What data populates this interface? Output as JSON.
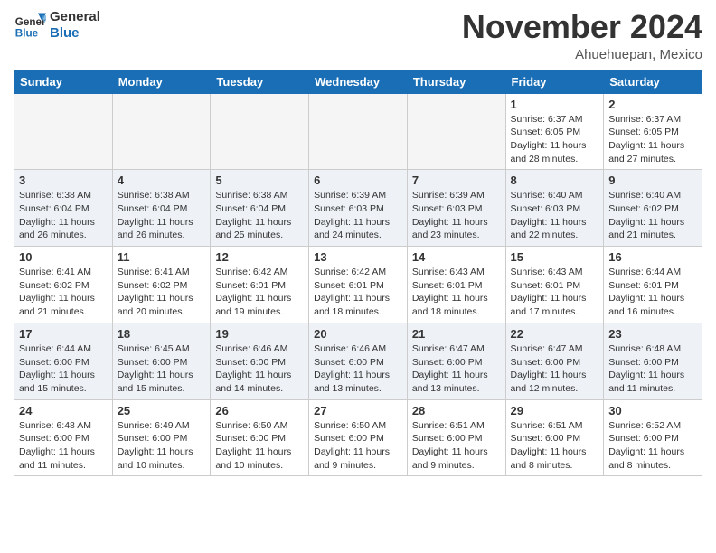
{
  "header": {
    "logo_general": "General",
    "logo_blue": "Blue",
    "month": "November 2024",
    "location": "Ahuehuepan, Mexico"
  },
  "weekdays": [
    "Sunday",
    "Monday",
    "Tuesday",
    "Wednesday",
    "Thursday",
    "Friday",
    "Saturday"
  ],
  "weeks": [
    [
      {
        "day": "",
        "info": ""
      },
      {
        "day": "",
        "info": ""
      },
      {
        "day": "",
        "info": ""
      },
      {
        "day": "",
        "info": ""
      },
      {
        "day": "",
        "info": ""
      },
      {
        "day": "1",
        "info": "Sunrise: 6:37 AM\nSunset: 6:05 PM\nDaylight: 11 hours and 28 minutes."
      },
      {
        "day": "2",
        "info": "Sunrise: 6:37 AM\nSunset: 6:05 PM\nDaylight: 11 hours and 27 minutes."
      }
    ],
    [
      {
        "day": "3",
        "info": "Sunrise: 6:38 AM\nSunset: 6:04 PM\nDaylight: 11 hours and 26 minutes."
      },
      {
        "day": "4",
        "info": "Sunrise: 6:38 AM\nSunset: 6:04 PM\nDaylight: 11 hours and 26 minutes."
      },
      {
        "day": "5",
        "info": "Sunrise: 6:38 AM\nSunset: 6:04 PM\nDaylight: 11 hours and 25 minutes."
      },
      {
        "day": "6",
        "info": "Sunrise: 6:39 AM\nSunset: 6:03 PM\nDaylight: 11 hours and 24 minutes."
      },
      {
        "day": "7",
        "info": "Sunrise: 6:39 AM\nSunset: 6:03 PM\nDaylight: 11 hours and 23 minutes."
      },
      {
        "day": "8",
        "info": "Sunrise: 6:40 AM\nSunset: 6:03 PM\nDaylight: 11 hours and 22 minutes."
      },
      {
        "day": "9",
        "info": "Sunrise: 6:40 AM\nSunset: 6:02 PM\nDaylight: 11 hours and 21 minutes."
      }
    ],
    [
      {
        "day": "10",
        "info": "Sunrise: 6:41 AM\nSunset: 6:02 PM\nDaylight: 11 hours and 21 minutes."
      },
      {
        "day": "11",
        "info": "Sunrise: 6:41 AM\nSunset: 6:02 PM\nDaylight: 11 hours and 20 minutes."
      },
      {
        "day": "12",
        "info": "Sunrise: 6:42 AM\nSunset: 6:01 PM\nDaylight: 11 hours and 19 minutes."
      },
      {
        "day": "13",
        "info": "Sunrise: 6:42 AM\nSunset: 6:01 PM\nDaylight: 11 hours and 18 minutes."
      },
      {
        "day": "14",
        "info": "Sunrise: 6:43 AM\nSunset: 6:01 PM\nDaylight: 11 hours and 18 minutes."
      },
      {
        "day": "15",
        "info": "Sunrise: 6:43 AM\nSunset: 6:01 PM\nDaylight: 11 hours and 17 minutes."
      },
      {
        "day": "16",
        "info": "Sunrise: 6:44 AM\nSunset: 6:01 PM\nDaylight: 11 hours and 16 minutes."
      }
    ],
    [
      {
        "day": "17",
        "info": "Sunrise: 6:44 AM\nSunset: 6:00 PM\nDaylight: 11 hours and 15 minutes."
      },
      {
        "day": "18",
        "info": "Sunrise: 6:45 AM\nSunset: 6:00 PM\nDaylight: 11 hours and 15 minutes."
      },
      {
        "day": "19",
        "info": "Sunrise: 6:46 AM\nSunset: 6:00 PM\nDaylight: 11 hours and 14 minutes."
      },
      {
        "day": "20",
        "info": "Sunrise: 6:46 AM\nSunset: 6:00 PM\nDaylight: 11 hours and 13 minutes."
      },
      {
        "day": "21",
        "info": "Sunrise: 6:47 AM\nSunset: 6:00 PM\nDaylight: 11 hours and 13 minutes."
      },
      {
        "day": "22",
        "info": "Sunrise: 6:47 AM\nSunset: 6:00 PM\nDaylight: 11 hours and 12 minutes."
      },
      {
        "day": "23",
        "info": "Sunrise: 6:48 AM\nSunset: 6:00 PM\nDaylight: 11 hours and 11 minutes."
      }
    ],
    [
      {
        "day": "24",
        "info": "Sunrise: 6:48 AM\nSunset: 6:00 PM\nDaylight: 11 hours and 11 minutes."
      },
      {
        "day": "25",
        "info": "Sunrise: 6:49 AM\nSunset: 6:00 PM\nDaylight: 11 hours and 10 minutes."
      },
      {
        "day": "26",
        "info": "Sunrise: 6:50 AM\nSunset: 6:00 PM\nDaylight: 11 hours and 10 minutes."
      },
      {
        "day": "27",
        "info": "Sunrise: 6:50 AM\nSunset: 6:00 PM\nDaylight: 11 hours and 9 minutes."
      },
      {
        "day": "28",
        "info": "Sunrise: 6:51 AM\nSunset: 6:00 PM\nDaylight: 11 hours and 9 minutes."
      },
      {
        "day": "29",
        "info": "Sunrise: 6:51 AM\nSunset: 6:00 PM\nDaylight: 11 hours and 8 minutes."
      },
      {
        "day": "30",
        "info": "Sunrise: 6:52 AM\nSunset: 6:00 PM\nDaylight: 11 hours and 8 minutes."
      }
    ]
  ]
}
